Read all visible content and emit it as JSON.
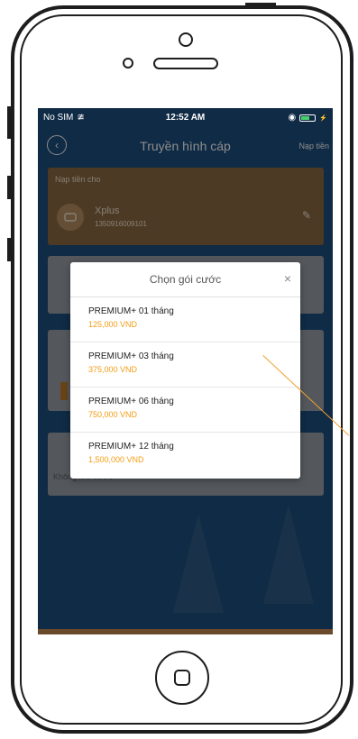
{
  "status_bar": {
    "carrier": "No SIM",
    "time": "12:52 AM"
  },
  "nav": {
    "title": "Truyền hình cáp",
    "right_action": "Nạp tiền"
  },
  "topup_card": {
    "label": "Nạp tiền cho",
    "account_name": "Xplus",
    "account_id": "1350916009101"
  },
  "background_field": {
    "placeholder": "Không lưu được"
  },
  "modal": {
    "title": "Chọn gói cước",
    "close": "×",
    "packages": [
      {
        "name": "PREMIUM+ 01 tháng",
        "price": "125,000 VND"
      },
      {
        "name": "PREMIUM+ 03 tháng",
        "price": "375,000 VND"
      },
      {
        "name": "PREMIUM+ 06 tháng",
        "price": "750,000 VND"
      },
      {
        "name": "PREMIUM+ 12 tháng",
        "price": "1,500,000 VND"
      }
    ]
  },
  "colors": {
    "screen_bg": "#1e4f7e",
    "topup_card": "#8d6b42",
    "price": "#f39c12",
    "annotation": "#f0a030"
  },
  "icons": {
    "back": "chevron-left-icon",
    "wifi": "wifi-icon",
    "edit": "pencil-icon",
    "account": "tv-icon",
    "close": "close-icon"
  }
}
